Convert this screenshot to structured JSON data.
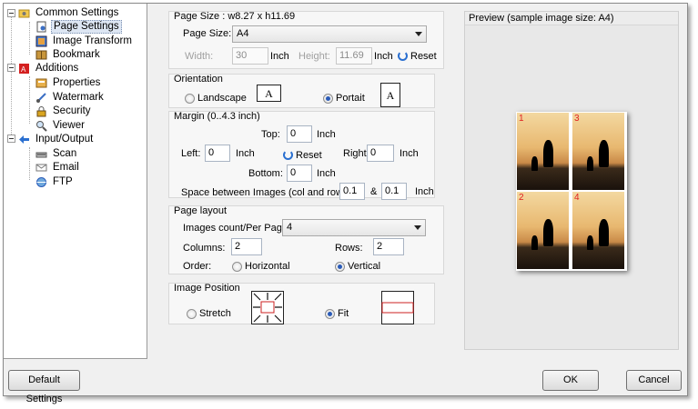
{
  "tree": [
    {
      "label": "Common Settings",
      "icon": "settings-folder-icon"
    },
    {
      "label": "Page Settings",
      "icon": "page-settings-icon"
    },
    {
      "label": "Image Transform",
      "icon": "image-transform-icon"
    },
    {
      "label": "Bookmark",
      "icon": "bookmark-icon"
    },
    {
      "label": "Additions",
      "icon": "pdf-additions-icon"
    },
    {
      "label": "Properties",
      "icon": "properties-icon"
    },
    {
      "label": "Watermark",
      "icon": "watermark-icon"
    },
    {
      "label": "Security",
      "icon": "lock-icon"
    },
    {
      "label": "Viewer",
      "icon": "viewer-icon"
    },
    {
      "label": "Input/Output",
      "icon": "input-output-arrow-icon"
    },
    {
      "label": "Scan",
      "icon": "scanner-icon"
    },
    {
      "label": "Email",
      "icon": "email-icon"
    },
    {
      "label": "FTP",
      "icon": "ftp-icon"
    }
  ],
  "page_size": {
    "title": "Page Size : w8.27 x h11.69",
    "label": "Page Size:",
    "value": "A4",
    "width_label": "Width:",
    "width_value": "30",
    "inch1": "Inch",
    "height_label": "Height:",
    "height_value": "11.69",
    "inch2": "Inch",
    "reset": "Reset"
  },
  "orientation": {
    "title": "Orientation",
    "landscape": "Landscape",
    "portrait": "Portait",
    "selected": "portrait",
    "glyph": "A"
  },
  "margin": {
    "title": "Margin (0..4.3 inch)",
    "top_label": "Top:",
    "top_value": "0",
    "left_label": "Left:",
    "left_value": "0",
    "right_label": "Right:",
    "right_value": "0",
    "bottom_label": "Bottom:",
    "bottom_value": "0",
    "inch": "Inch",
    "reset": "Reset",
    "space_label": "Space between Images (col and row) :",
    "space_col": "0.1",
    "amp": "&",
    "space_row": "0.1"
  },
  "layout": {
    "title": "Page layout",
    "count_label": "Images count/Per Page",
    "count_value": "4",
    "columns_label": "Columns:",
    "columns_value": "2",
    "rows_label": "Rows:",
    "rows_value": "2",
    "order_label": "Order:",
    "horizontal": "Horizontal",
    "vertical": "Vertical",
    "selected": "vertical"
  },
  "image_position": {
    "title": "Image Position",
    "stretch": "Stretch",
    "fit": "Fit",
    "selected": "fit"
  },
  "preview": {
    "title": "Preview (sample image size: A4)",
    "numbers": [
      "1",
      "3",
      "2",
      "4"
    ]
  },
  "buttons": {
    "default": "Default Settings",
    "ok": "OK",
    "cancel": "Cancel"
  },
  "colors": {
    "accent": "#2a5bb8",
    "page_number": "#e02020",
    "fit_box": "#cc2020"
  }
}
